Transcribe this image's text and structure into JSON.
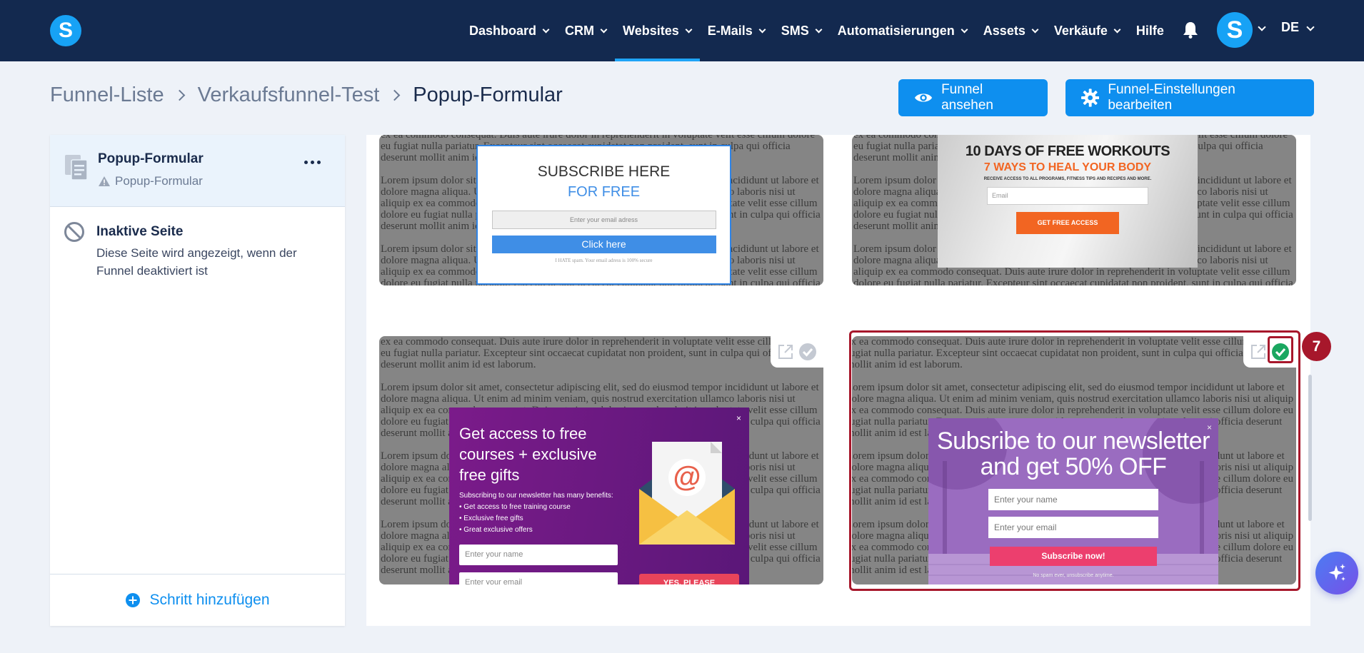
{
  "nav": {
    "logo": "S",
    "items": [
      {
        "label": "Dashboard",
        "dropdown": true,
        "active": false
      },
      {
        "label": "CRM",
        "dropdown": true,
        "active": false
      },
      {
        "label": "Websites",
        "dropdown": true,
        "active": true
      },
      {
        "label": "E-Mails",
        "dropdown": true,
        "active": false
      },
      {
        "label": "SMS",
        "dropdown": true,
        "active": false
      },
      {
        "label": "Automatisierungen",
        "dropdown": true,
        "active": false
      },
      {
        "label": "Assets",
        "dropdown": true,
        "active": false
      },
      {
        "label": "Verkäufe",
        "dropdown": true,
        "active": false
      },
      {
        "label": "Hilfe",
        "dropdown": false,
        "active": false
      }
    ],
    "avatar": "S",
    "language": "DE"
  },
  "breadcrumb": [
    "Funnel-Liste",
    "Verkaufsfunnel-Test",
    "Popup-Formular"
  ],
  "actions": {
    "view_funnel": "Funnel ansehen",
    "edit_settings": "Funnel-Einstellungen bearbeiten"
  },
  "sidebar": {
    "step": {
      "title": "Popup-Formular",
      "subtitle": "Popup-Formular"
    },
    "inactive": {
      "title": "Inaktive Seite",
      "description": "Diese Seite wird angezeigt, wenn der Funnel deaktiviert ist"
    },
    "add_step": "Schritt hinzufügen"
  },
  "templates": {
    "lorem_a": "ex ea commodo consequat. Duis aute irure dolor in reprehenderit in voluptate velit esse cillum dolore eu fugiat nulla pariatur. Excepteur sint occaecat cupidatat non proident, sunt in culpa qui officia deserunt mollit anim id est laborum.",
    "lorem_b": "Lorem ipsum dolor sit amet, consectetur adipiscing elit, sed do eiusmod tempor incididunt ut labore et dolore magna aliqua. Ut enim ad minim veniam, quis nostrud exercitation ullamco laboris nisi ut aliquip ex ea commodo consequat. Duis aute irure dolor in reprehenderit in voluptate velit esse cillum dolore eu fugiat nulla pariatur. Excepteur sint occaecat cupidatat non proident, sunt in culpa qui officia deserunt mollit anim id est laborum.",
    "popup1": {
      "heading": "SUBSCRIBE HERE",
      "subheading": "FOR FREE",
      "email_placeholder": "Enter your email adress",
      "button": "Click here",
      "note": "I HATE spam. Your email adress is 100% secure"
    },
    "popup2": {
      "heading": "10 DAYS OF FREE WORKOUTS",
      "subheading": "7 WAYS TO HEAL YOUR BODY",
      "small": "RECEIVE ACCESS TO ALL PROGRAMS, FITNESS TIPS AND RECIPES AND MORE.",
      "email_placeholder": "Email",
      "button": "GET FREE ACCESS"
    },
    "popup3": {
      "title": "Get access to free courses + exclusive free gifts",
      "intro": "Subscribing to our newsletter has many benefits:",
      "bullets": [
        "• Get access to free training course",
        "• Exclusive free gifts",
        "• Great exclusive offers"
      ],
      "name_placeholder": "Enter your name",
      "email_placeholder": "Enter your email",
      "button": "YES, PLEASE",
      "close": "×"
    },
    "popup4": {
      "title": "Subsribe to our newsletter and get 50% OFF",
      "name_placeholder": "Enter your name",
      "email_placeholder": "Enter your email",
      "button": "Subscribe now!",
      "note": "No spam ever, unsubscribe anytime.",
      "close": "×"
    }
  },
  "annotation": {
    "step_number": "7"
  },
  "colors": {
    "nav_bg": "#13294f",
    "accent": "#0e8fef",
    "annotation": "#a7172b",
    "selected_check": "#1aa760"
  }
}
